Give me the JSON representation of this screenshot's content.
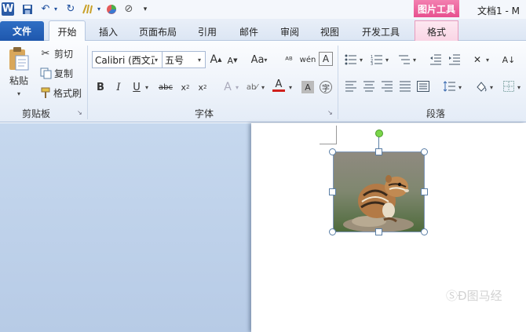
{
  "quick_access": {
    "app_icon": "word-icon",
    "save": "save-icon",
    "undo": "undo-icon",
    "redo": "redo-icon"
  },
  "context_tab": {
    "group": "图片工具"
  },
  "title": "文档1 - M",
  "tabs": [
    "文件",
    "开始",
    "插入",
    "页面布局",
    "引用",
    "邮件",
    "审阅",
    "视图",
    "开发工具",
    "格式"
  ],
  "clipboard": {
    "paste": "粘贴",
    "cut": "剪切",
    "copy": "复制",
    "format_painter": "格式刷",
    "label": "剪贴板"
  },
  "font": {
    "name": "Calibri (西文正",
    "size": "五号",
    "label": "字体"
  },
  "paragraph": {
    "label": "段落"
  },
  "colors": {
    "file_tab": "#1e57ad",
    "context": "#e7508f",
    "accent_red": "#d0201c"
  },
  "watermark": "ⓈÐ图马经"
}
